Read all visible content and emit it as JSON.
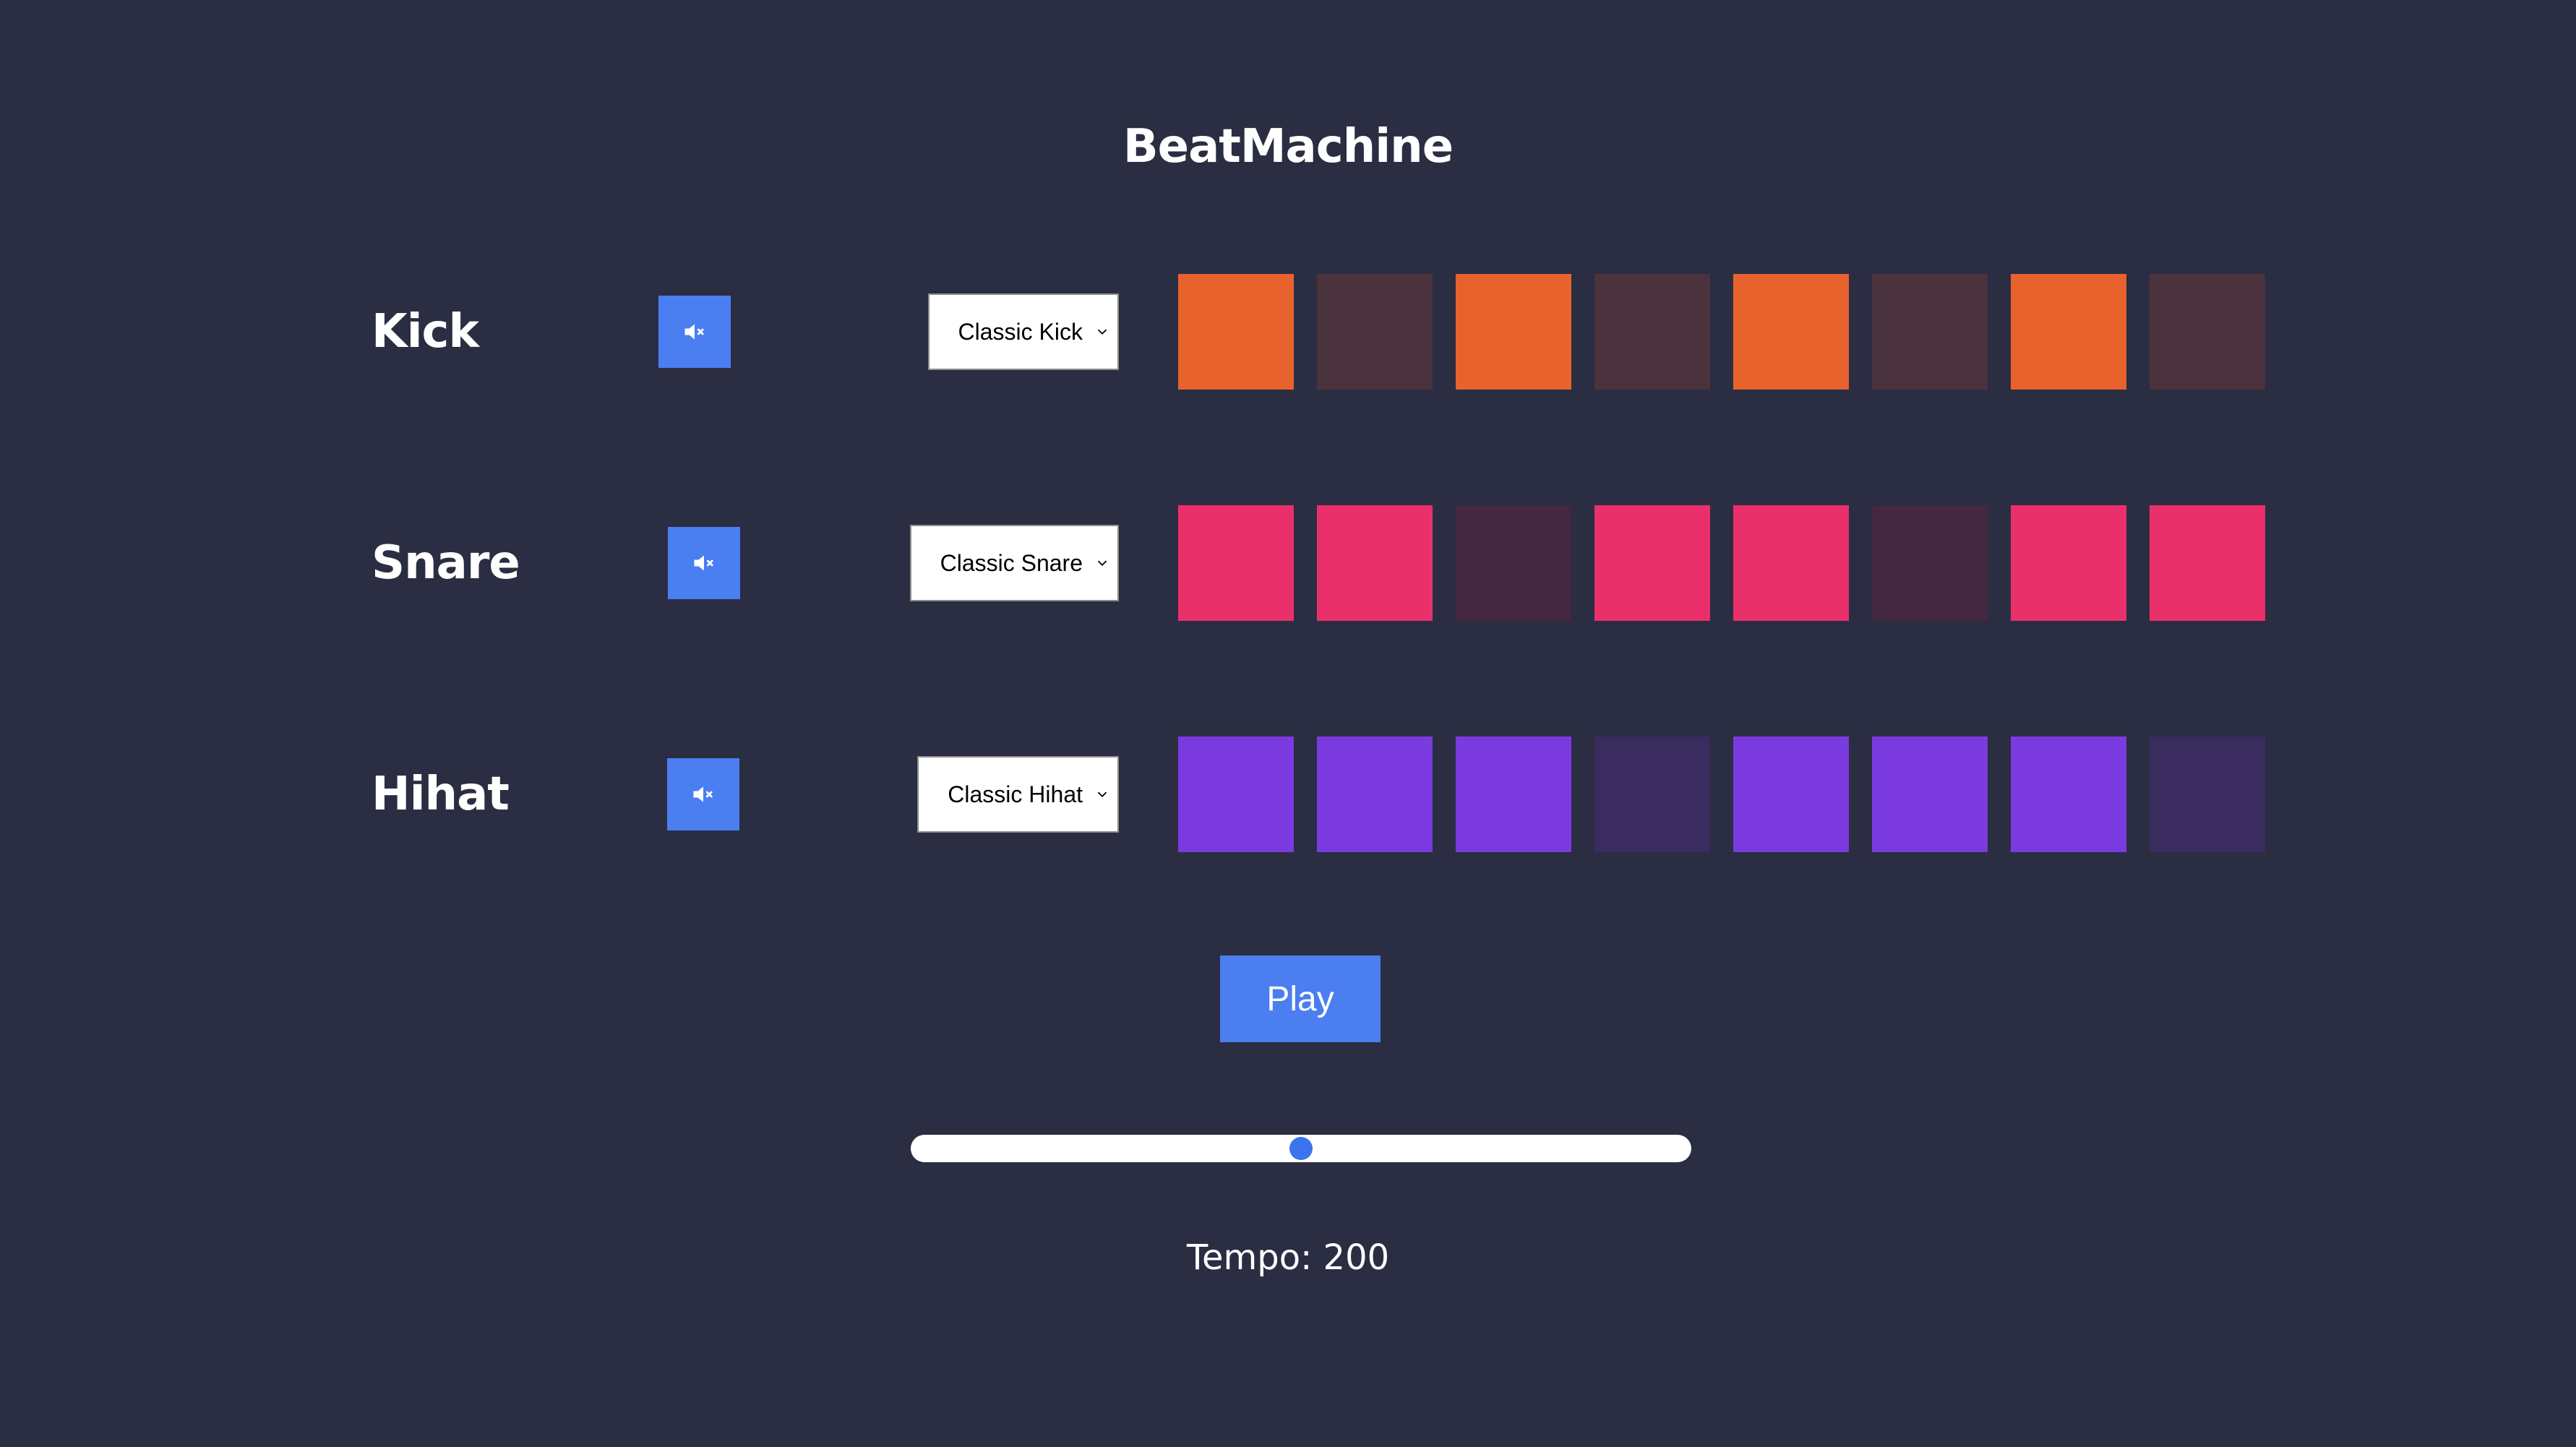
{
  "app": {
    "title": "BeatMachine"
  },
  "tracks": [
    {
      "name": "Kick",
      "mute_icon": "speaker-muted-icon",
      "sound_selected": "Classic Kick",
      "pads": [
        true,
        false,
        true,
        false,
        true,
        false,
        true,
        false
      ],
      "active_color": "#e8622e",
      "inactive_color": "#4a333d"
    },
    {
      "name": "Snare",
      "mute_icon": "speaker-muted-icon",
      "sound_selected": "Classic Snare",
      "pads": [
        true,
        true,
        false,
        true,
        true,
        false,
        true,
        true
      ],
      "active_color": "#ea306b",
      "inactive_color": "#43283f"
    },
    {
      "name": "Hihat",
      "mute_icon": "speaker-muted-icon",
      "sound_selected": "Classic Hihat",
      "pads": [
        true,
        true,
        true,
        false,
        true,
        true,
        true,
        false
      ],
      "active_color": "#7a3ae0",
      "inactive_color": "#3a2c5e"
    }
  ],
  "controls": {
    "play_label": "Play",
    "tempo_text": "Tempo: 200",
    "tempo_value": 200,
    "tempo_slider_fraction": 0.5
  },
  "colors": {
    "background": "#2b2d42",
    "accent": "#4b7ef0"
  }
}
